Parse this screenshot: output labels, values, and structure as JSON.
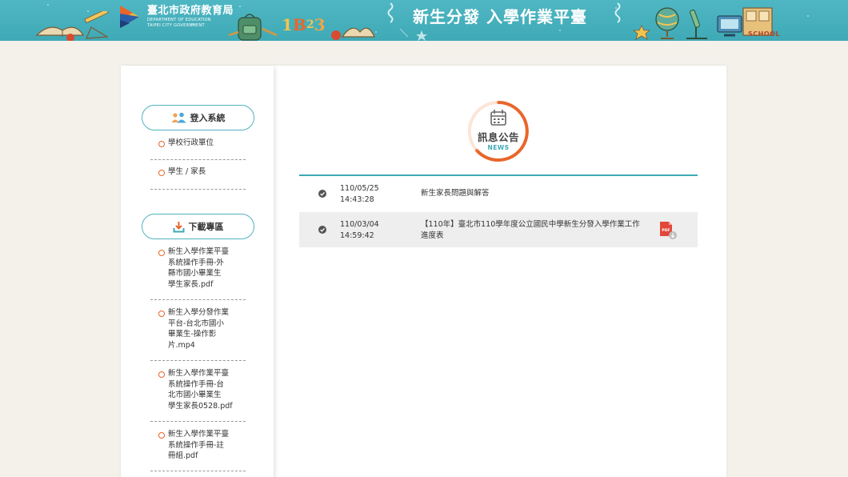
{
  "header": {
    "org_title": "臺北市政府教育局",
    "org_sub1": "DEPARTMENT OF EDUCATION",
    "org_sub2": "TAIPEI CITY GOVERNMENT",
    "site_title": "新生分發 入學作業平臺",
    "deco_numbers": [
      "1",
      "B",
      "2",
      "3"
    ],
    "deco_school": "SCHOOL"
  },
  "sidebar": {
    "login": {
      "label": "登入系統",
      "icon": "users-icon",
      "items": [
        {
          "label": "學校行政單位"
        },
        {
          "label": "學生 / 家長"
        }
      ]
    },
    "download": {
      "label": "下載專區",
      "icon": "download-icon",
      "items": [
        {
          "lines": [
            "新生入學作業平臺",
            "系統操作手冊-外",
            "縣市國小畢業生",
            "學生家長.pdf"
          ]
        },
        {
          "lines": [
            "新生入學分發作業",
            "平台-台北市國小",
            "畢業生-操作影",
            "片.mp4"
          ]
        },
        {
          "lines": [
            "新生入學作業平臺",
            "系統操作手冊-台",
            "北市國小畢業生",
            "學生家長0528.pdf"
          ]
        },
        {
          "lines": [
            "新生入學作業平臺",
            "系統操作手冊-註",
            "冊組.pdf"
          ]
        }
      ]
    }
  },
  "news": {
    "label": "訊息公告",
    "sub": "NEWS",
    "icon": "calendar-icon",
    "accent": "#e8662b",
    "items": [
      {
        "date": "110/05/25",
        "time": "14:43:28",
        "title_lines": [
          "新生家長問題與解答"
        ],
        "has_pdf": false
      },
      {
        "date": "110/03/04",
        "time": "14:59:42",
        "title_lines": [
          "【110年】臺北市110學年度公立國民中學新生分發入學作業工作",
          "進度表"
        ],
        "has_pdf": true,
        "pdf_label": "PDF"
      }
    ]
  },
  "colors": {
    "header": "#4fb7c3",
    "teal": "#3fa9b6",
    "orange": "#e8662b",
    "background": "#f3f1ea"
  }
}
